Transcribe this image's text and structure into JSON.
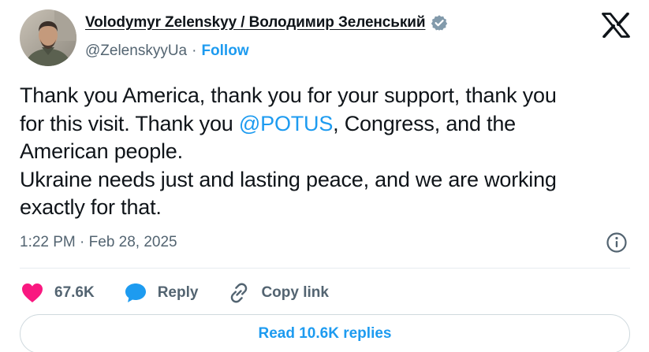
{
  "author": {
    "display_name": "Volodymyr Zelenskyy / Володимир Зеленський",
    "handle": "@ZelenskyyUa",
    "separator": "·",
    "follow_label": "Follow"
  },
  "tweet": {
    "lines": [
      [
        {
          "text": "Thank you America, thank you for your support, thank you"
        }
      ],
      [
        {
          "text": "for this visit. Thank you "
        },
        {
          "text": "@POTUS",
          "mention": true
        },
        {
          "text": ", Congress, and the"
        }
      ],
      [
        {
          "text": "American people."
        }
      ],
      [
        {
          "text": "Ukraine needs just and lasting peace, and we are working"
        }
      ],
      [
        {
          "text": "exactly for that."
        }
      ]
    ],
    "timestamp": "1:22 PM · Feb 28, 2025"
  },
  "actions": {
    "like_count": "67.6K",
    "reply_label": "Reply",
    "copy_link_label": "Copy link"
  },
  "read_replies_label": "Read 10.6K replies",
  "colors": {
    "accent": "#1d9bf0",
    "like": "#f91880",
    "text": "#0f1419",
    "muted": "#536471",
    "verified": "#829aab"
  },
  "icons": {
    "verified": "verified-badge-icon",
    "brand": "x-logo-icon",
    "info": "info-icon",
    "like": "heart-icon",
    "reply": "speech-bubble-icon",
    "copy_link": "link-icon"
  }
}
